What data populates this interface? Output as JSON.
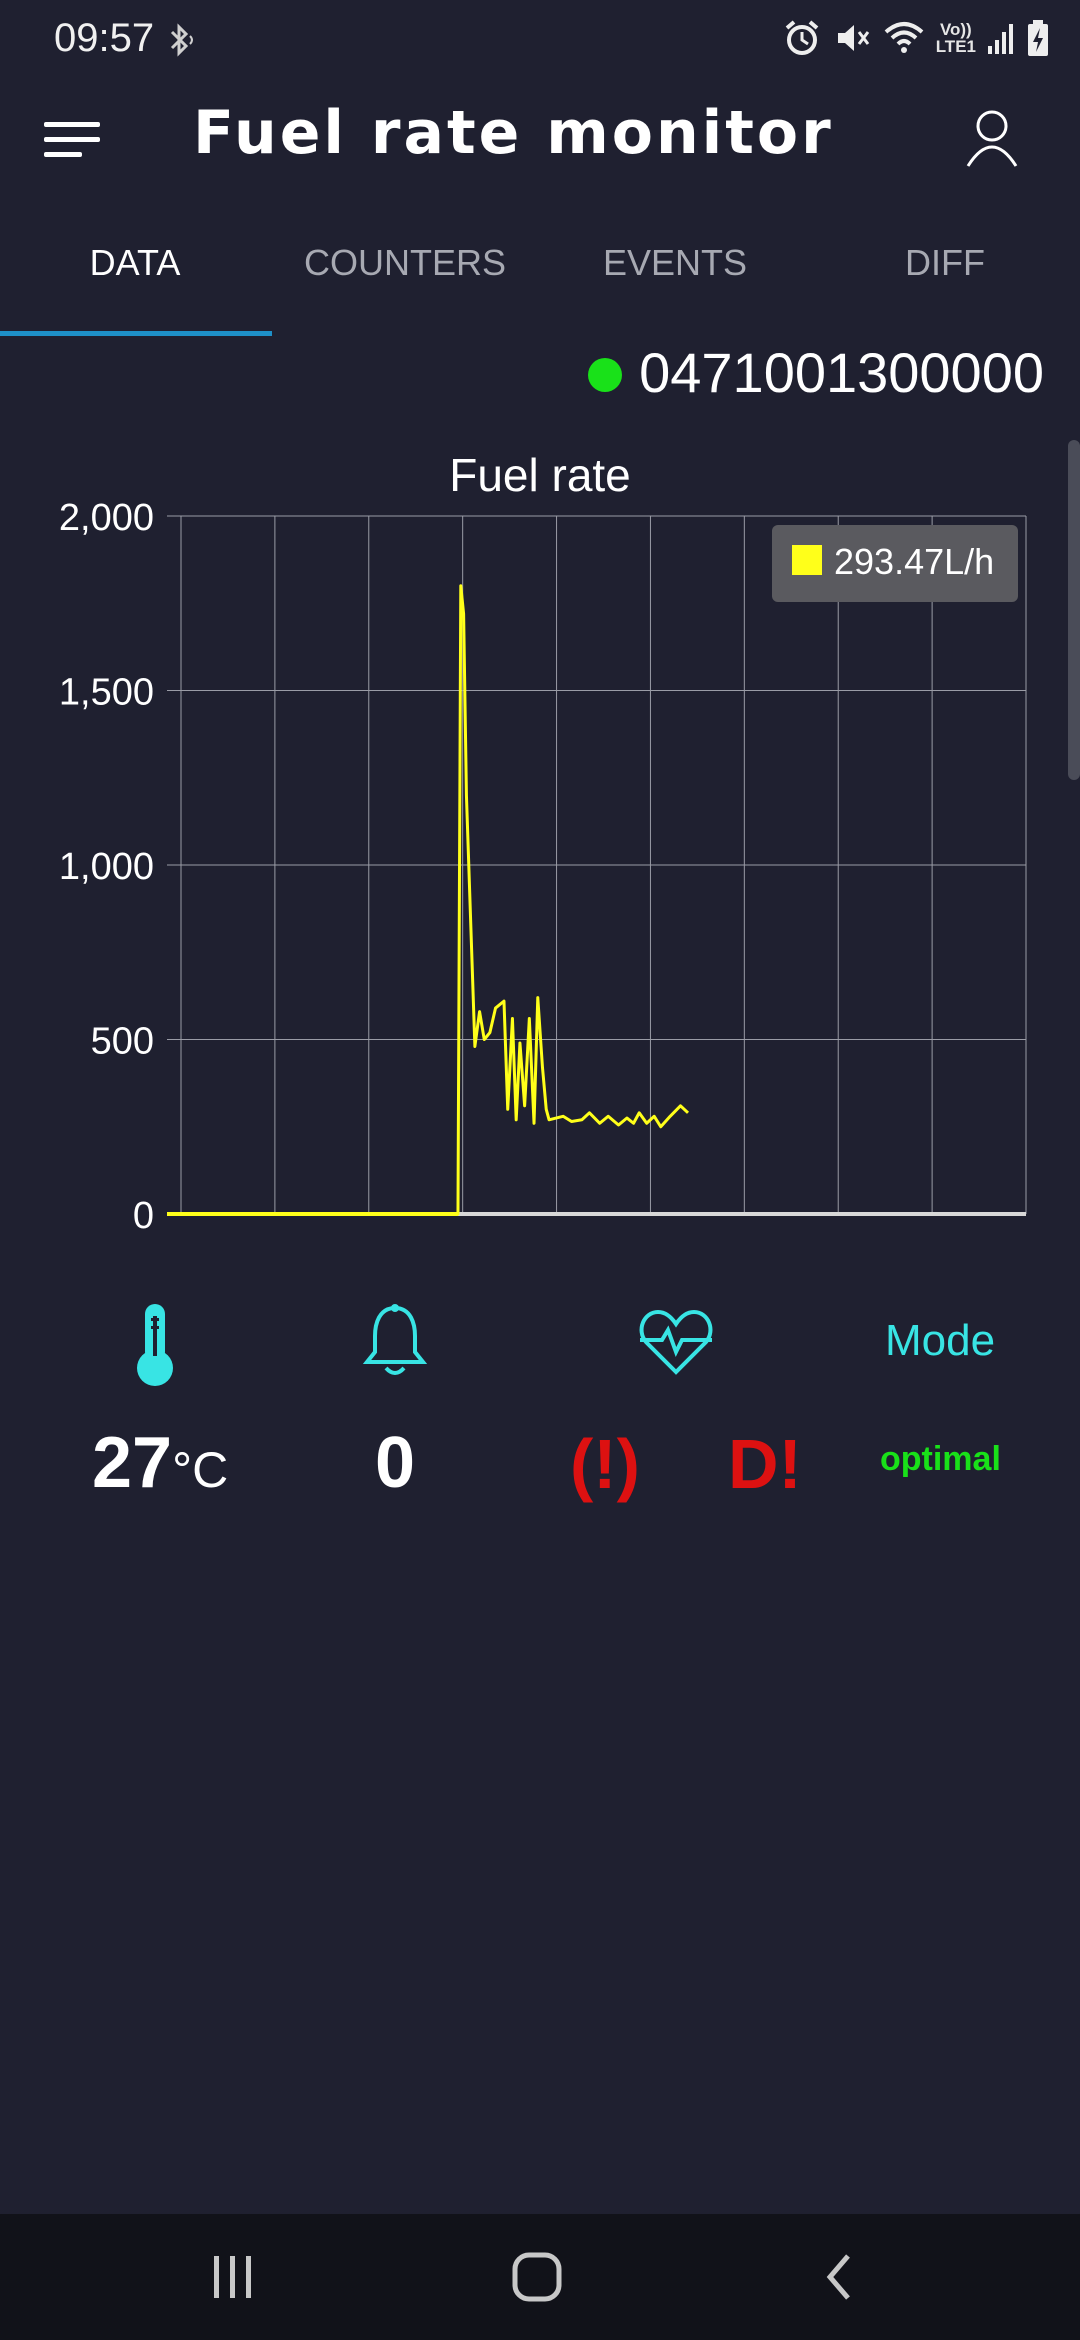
{
  "status_bar": {
    "time": "09:57",
    "lte_top": "Vo))",
    "lte_bottom": "LTE1",
    "icons": [
      "bluetooth-icon",
      "alarm-icon",
      "mute-icon",
      "wifi-icon",
      "signal-icon",
      "battery-charging-icon"
    ]
  },
  "app_bar": {
    "title": "Fuel rate monitor",
    "menu_icon": "hamburger-menu-icon",
    "account_icon": "account-icon"
  },
  "tabs": [
    {
      "label": "DATA",
      "active": true
    },
    {
      "label": "COUNTERS",
      "active": false
    },
    {
      "label": "EVENTS",
      "active": false
    },
    {
      "label": "DIFF",
      "active": false
    }
  ],
  "device": {
    "id": "0471001300000",
    "status_color": "#19e119"
  },
  "chart": {
    "tooltip_value": "293.47L/h",
    "tooltip_color": "#ffff1a"
  },
  "chart_data": {
    "type": "line",
    "title": "Fuel rate",
    "xlabel": "",
    "ylabel": "",
    "ylim": [
      0,
      2000
    ],
    "yticks": [
      "0",
      "500",
      "1,000",
      "1,500",
      "2,000"
    ],
    "ytick_values": [
      0,
      500,
      1000,
      1500,
      2000
    ],
    "xlim": [
      0,
      90
    ],
    "grid": true,
    "series": [
      {
        "color": "#ffff1a",
        "x": [
          0,
          29.5,
          29.8,
          30.1,
          30.4,
          31.3,
          31.8,
          32.3,
          32.9,
          33.5,
          34.4,
          34.8,
          35.3,
          35.7,
          36.1,
          36.6,
          37.1,
          37.6,
          38,
          38.5,
          38.9,
          39.2,
          40.7,
          41.6,
          42.7,
          43.5,
          44.6,
          45.5,
          46.6,
          47.5,
          48.2,
          48.8,
          49.6,
          50.4,
          51.1,
          52.1,
          53.2,
          54
        ],
        "y": [
          0,
          0,
          1800,
          1720,
          1200,
          480,
          580,
          500,
          520,
          590,
          610,
          300,
          560,
          270,
          490,
          310,
          560,
          260,
          620,
          420,
          300,
          270,
          280,
          265,
          270,
          290,
          260,
          280,
          255,
          275,
          260,
          290,
          260,
          280,
          250,
          280,
          310,
          290
        ]
      }
    ],
    "tooltip": "293.47L/h"
  },
  "metrics": {
    "temperature_icon": "thermometer-icon",
    "temperature_value": "27",
    "temperature_unit": "°C",
    "alarm_icon": "bell-icon",
    "alarm_count": "0",
    "health_icon": "heartbeat-icon",
    "warning_text": "(!)",
    "diag_text": "D!",
    "mode_label": "Mode",
    "mode_value": "optimal",
    "colors": {
      "cyan": "#38e4e4",
      "red": "#dd1111",
      "green": "#19e119"
    }
  },
  "nav_bar": {
    "icons": [
      "recent-apps-icon",
      "home-icon",
      "back-icon"
    ]
  }
}
